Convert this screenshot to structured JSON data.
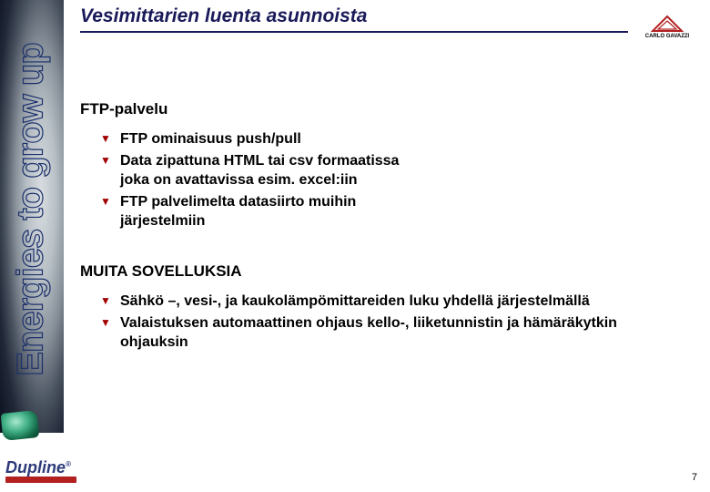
{
  "sidebar": {
    "tagline": "Energies to grow up"
  },
  "header": {
    "title": "Vesimittarien luenta asunnoista"
  },
  "brand": {
    "name": "CARLO GAVAZZI"
  },
  "section1": {
    "heading": "FTP-palvelu",
    "items": [
      "FTP ominaisuus push/pull",
      "Data zipattuna HTML tai csv formaatissa joka on avattavissa esim. excel:iin",
      "FTP palvelimelta datasiirto muihin järjestelmiin"
    ]
  },
  "section2": {
    "heading": "MUITA SOVELLUKSIA",
    "items": [
      "Sähkö –, vesi-, ja kaukolämpömittareiden luku yhdellä järjestelmällä",
      "Valaistuksen automaattinen ohjaus kello-, liiketunnistin ja hämäräkytkin ohjauksin"
    ]
  },
  "footer": {
    "logo": "Dupline",
    "page": "7"
  }
}
